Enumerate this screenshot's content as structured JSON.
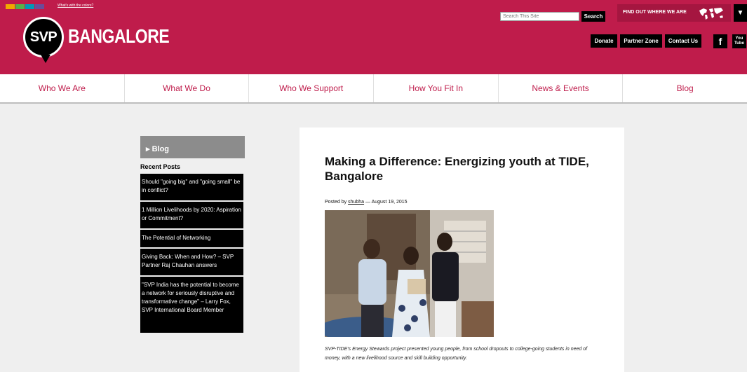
{
  "header": {
    "strip_colors": [
      "#f2a900",
      "#56b14a",
      "#0099b8",
      "#6b4c9a",
      "#bf1c4b",
      "#1f4e9c"
    ],
    "colors_link": "What's with the colors?",
    "logo_mark": "SVP",
    "logo_city": "BANGALORE",
    "search_placeholder": "Search This Site",
    "search_button": "Search",
    "find_label": "FIND OUT WHERE WE ARE",
    "toggle": "▼",
    "links": [
      "Donate",
      "Partner Zone",
      "Contact Us"
    ],
    "social": [
      "f",
      "You Tube"
    ]
  },
  "nav": [
    "Who We Are",
    "What We Do",
    "Who We Support",
    "How You Fit In",
    "News & Events",
    "Blog"
  ],
  "sidebar": {
    "heading": "▸ Blog",
    "recent_label": "Recent Posts",
    "posts": [
      "Should \"going big\" and \"going small\" be in conflict?",
      "1 Million Livelihoods by 2020: Aspiration or Commitment?",
      "The Potential of Networking",
      "Giving Back: When and How? – SVP Partner Raj Chauhan answers",
      "\"SVP India has the potential to become a network for seriously disruptive and transformative change\" – Larry Fox, SVP International Board Member"
    ]
  },
  "article": {
    "title": "Making a Difference: Energizing youth at TIDE, Bangalore",
    "posted_by": "Posted by",
    "author": "shubha",
    "separator": "—",
    "date": "August 19, 2015",
    "caption": "SVP-TIDE's Energy Stewards project presented young people, from school dropouts to college-going students in need of money, with a new livelihood source and skill building opportunity."
  },
  "colors": {
    "brand": "#bf1c4b",
    "nav_text": "#bf1c4b",
    "sidebar_head": "#8c8c8c"
  }
}
